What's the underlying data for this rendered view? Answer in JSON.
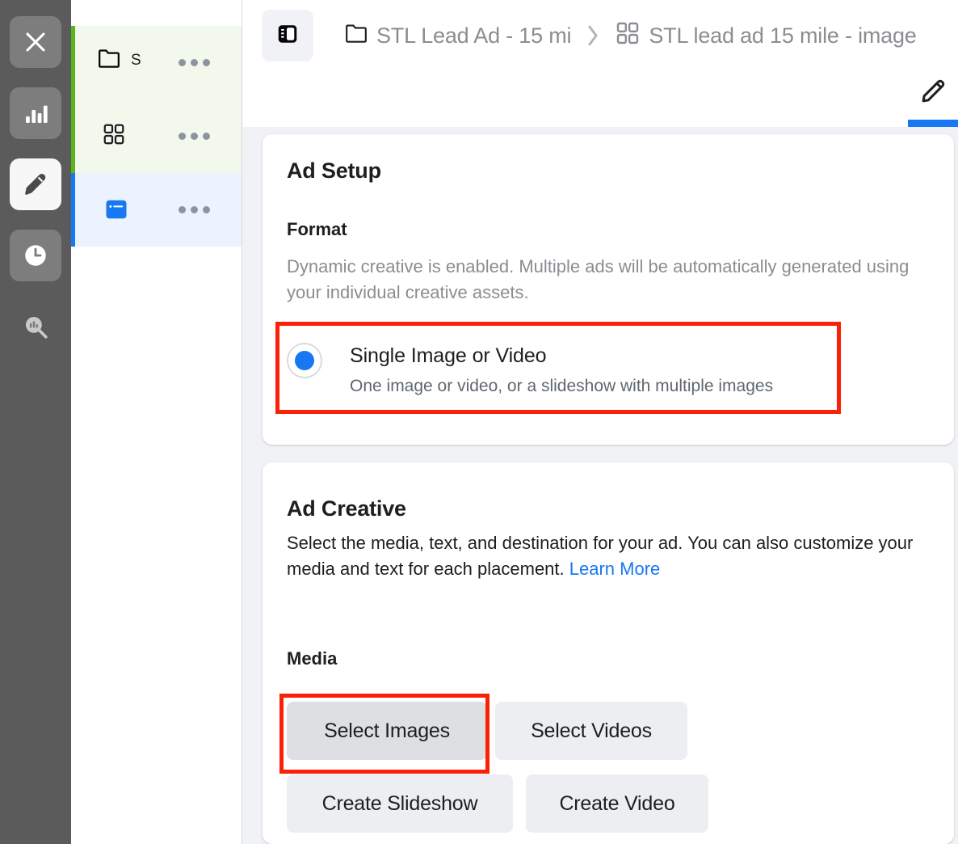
{
  "rail": {
    "items": [
      {
        "name": "close-icon",
        "label": "Close",
        "active": false
      },
      {
        "name": "chart-bars-icon",
        "label": "Reporting",
        "active": false
      },
      {
        "name": "pencil-icon",
        "label": "Edit",
        "active": true
      },
      {
        "name": "clock-icon",
        "label": "History",
        "active": false
      },
      {
        "name": "search-chart-icon",
        "label": "Inspect",
        "active": false
      }
    ]
  },
  "tree": {
    "rows": [
      {
        "icon": "folder-icon",
        "label": "S",
        "accent_color": "#56b61a",
        "row_background": "#f2f8ec",
        "menu": "more-options"
      },
      {
        "icon": "grid-squares-icon",
        "label": "",
        "accent_color": "#56b61a",
        "row_background": "#f2f8ec",
        "menu": "more-options"
      },
      {
        "icon": "ad-card-icon",
        "label": "",
        "accent_color": "#1877f2",
        "row_background": "#ebf3fe",
        "menu": "more-options"
      }
    ]
  },
  "header": {
    "sidebar_toggle_icon": "panel-layout-icon",
    "breadcrumb": [
      {
        "icon": "folder-icon",
        "label": "STL Lead Ad - 15 mi"
      },
      {
        "icon": "grid-squares-icon",
        "label": "STL lead ad 15 mile - image"
      }
    ],
    "separator": "›",
    "tabs": [
      {
        "name": "edit-tab",
        "icon": "pencil-icon",
        "active": true
      }
    ]
  },
  "ad_setup": {
    "title": "Ad Setup",
    "format_label": "Format",
    "format_description": "Dynamic creative is enabled. Multiple ads will be automatically generated using your individual creative assets.",
    "format_options": [
      {
        "label": "Single Image or Video",
        "description": "One image or video, or a slideshow with multiple images",
        "selected": true,
        "highlighted": true
      }
    ]
  },
  "ad_creative": {
    "title": "Ad Creative",
    "description_part1": "Select the media, text, and destination for your ad. You can also customize your media and text for each placement. ",
    "learn_more": "Learn More",
    "media_label": "Media",
    "media_buttons": [
      {
        "label": "Select Images",
        "highlighted": true,
        "hovered": true
      },
      {
        "label": "Select Videos",
        "highlighted": false,
        "hovered": false
      },
      {
        "label": "Create Slideshow",
        "highlighted": false,
        "hovered": false
      },
      {
        "label": "Create Video",
        "highlighted": false,
        "hovered": false
      }
    ]
  },
  "colors": {
    "accent_blue": "#1877f2",
    "accent_green": "#56b61a",
    "annotation_red": "#fa2108",
    "rail_background": "#5b5b5b",
    "content_background": "#f0f2f5",
    "button_background": "#eceef1",
    "text_primary": "#1c1e21",
    "text_secondary": "#8a8d91"
  }
}
